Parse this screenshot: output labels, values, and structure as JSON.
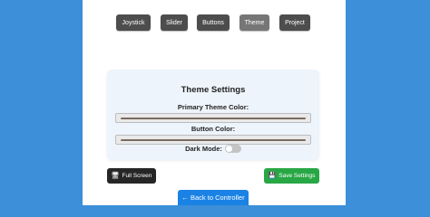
{
  "tabs": [
    {
      "label": "Joystick",
      "active": false
    },
    {
      "label": "Slider",
      "active": false
    },
    {
      "label": "Buttons",
      "active": false
    },
    {
      "label": "Theme",
      "active": true
    },
    {
      "label": "Project",
      "active": false
    }
  ],
  "settings": {
    "title": "Theme Settings",
    "primary_label": "Primary Theme Color:",
    "button_label": "Button Color:",
    "dark_mode_label": "Dark Mode:",
    "dark_mode_enabled": false
  },
  "actions": {
    "full_screen": {
      "icon": "monitor-icon",
      "label": "Full Screen"
    },
    "save": {
      "icon": "floppy-disk-icon",
      "label": "Save Settings"
    },
    "back": {
      "label": "← Back to Controller"
    }
  },
  "colors": {
    "background": "#3c8fd8",
    "tab": "#4d4d4d",
    "tab_active": "#767676",
    "card": "#edf4fb",
    "save": "#28a745",
    "back": "#1a82e5"
  }
}
